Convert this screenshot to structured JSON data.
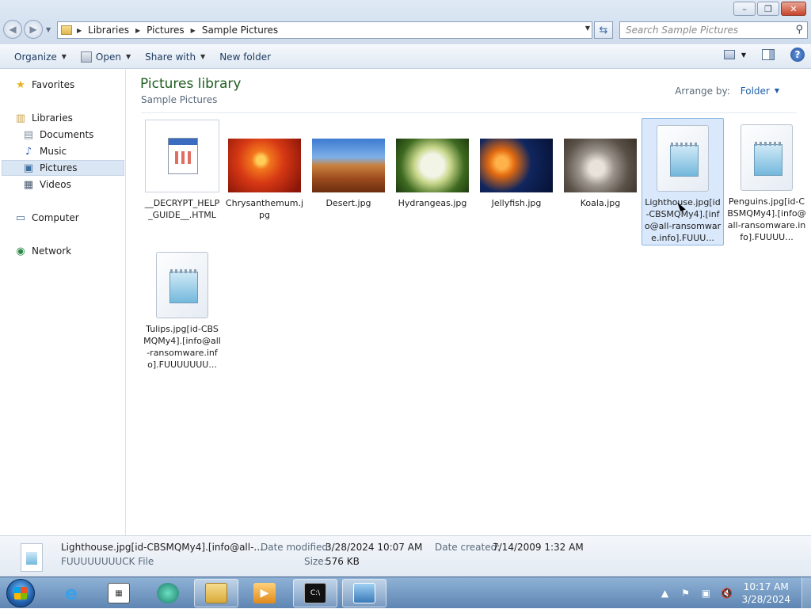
{
  "window": {
    "controls": {
      "minimize": "–",
      "maximize": "❐",
      "close": "✕"
    }
  },
  "address": {
    "crumbs": [
      "Libraries",
      "Pictures",
      "Sample Pictures"
    ],
    "search_placeholder": "Search Sample Pictures"
  },
  "toolbar": {
    "organize": "Organize",
    "open": "Open",
    "share_with": "Share with",
    "new_folder": "New folder",
    "help": "?"
  },
  "nav": {
    "favorites": "Favorites",
    "libraries": "Libraries",
    "documents": "Documents",
    "music": "Music",
    "pictures": "Pictures",
    "videos": "Videos",
    "computer": "Computer",
    "network": "Network"
  },
  "library": {
    "title": "Pictures library",
    "subtitle": "Sample Pictures",
    "arrange_label": "Arrange by:",
    "arrange_value": "Folder"
  },
  "files": [
    {
      "name": "__DECRYPT_HELP_GUIDE__.HTML",
      "kind": "html"
    },
    {
      "name": "Chrysanthemum.jpg",
      "kind": "photo"
    },
    {
      "name": "Desert.jpg",
      "kind": "photo"
    },
    {
      "name": "Hydrangeas.jpg",
      "kind": "photo"
    },
    {
      "name": "Jellyfish.jpg",
      "kind": "photo"
    },
    {
      "name": "Koala.jpg",
      "kind": "photo"
    },
    {
      "name": "Lighthouse.jpg[id-CBSMQMy4].[info@all-ransomware.info].FUUU...",
      "kind": "encrypted",
      "selected": true
    },
    {
      "name": "Penguins.jpg[id-CBSMQMy4].[info@all-ransomware.info].FUUUU...",
      "kind": "encrypted"
    },
    {
      "name": "Tulips.jpg[id-CBSMQMy4].[info@all-ransomware.info].FUUUUUUU...",
      "kind": "encrypted"
    }
  ],
  "details": {
    "name": "Lighthouse.jpg[id-CBSMQMy4].[info@all-...",
    "type": "FUUUUUUUUCK File",
    "date_modified_label": "Date modified:",
    "date_modified": "3/28/2024 10:07 AM",
    "size_label": "Size:",
    "size": "576 KB",
    "date_created_label": "Date created:",
    "date_created": "7/14/2009 1:32 AM"
  },
  "taskbar": {
    "time": "10:17 AM",
    "date": "3/28/2024"
  }
}
